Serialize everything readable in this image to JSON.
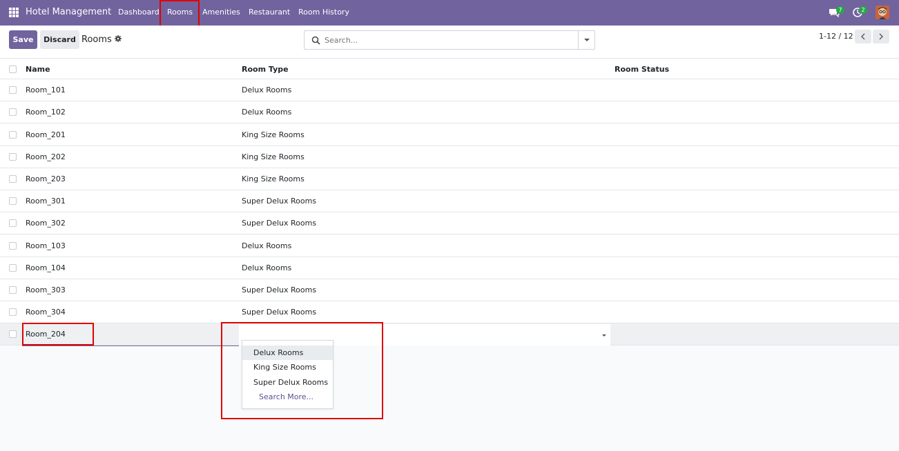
{
  "navbar": {
    "app_title": "Hotel Management",
    "menu": [
      "Dashboard",
      "Rooms",
      "Amenities",
      "Restaurant",
      "Room History"
    ],
    "messages_count": "7",
    "activities_count": "2"
  },
  "control": {
    "save_label": "Save",
    "discard_label": "Discard",
    "title": "Rooms",
    "search_placeholder": "Search...",
    "pager": "1-12 / 12"
  },
  "table": {
    "headers": [
      "Name",
      "Room Type",
      "Room Status"
    ],
    "rows": [
      {
        "name": "Room_101",
        "type": "Delux Rooms",
        "status": ""
      },
      {
        "name": "Room_102",
        "type": "Delux Rooms",
        "status": ""
      },
      {
        "name": "Room_201",
        "type": "King Size Rooms",
        "status": ""
      },
      {
        "name": "Room_202",
        "type": "King Size Rooms",
        "status": ""
      },
      {
        "name": "Room_203",
        "type": "King Size Rooms",
        "status": ""
      },
      {
        "name": "Room_301",
        "type": "Super Delux Rooms",
        "status": ""
      },
      {
        "name": "Room_302",
        "type": "Super Delux Rooms",
        "status": ""
      },
      {
        "name": "Room_103",
        "type": "Delux Rooms",
        "status": ""
      },
      {
        "name": "Room_104",
        "type": "Delux Rooms",
        "status": ""
      },
      {
        "name": "Room_303",
        "type": "Super Delux Rooms",
        "status": ""
      },
      {
        "name": "Room_304",
        "type": "Super Delux Rooms",
        "status": ""
      }
    ],
    "editing_row": {
      "name": "Room_204",
      "type": ""
    }
  },
  "dropdown": {
    "options": [
      "Delux Rooms",
      "King Size Rooms",
      "Super Delux Rooms"
    ],
    "search_more": "Search More..."
  },
  "colors": {
    "brand": "#71639e",
    "highlight": "#e00000",
    "badge": "#28a745"
  }
}
